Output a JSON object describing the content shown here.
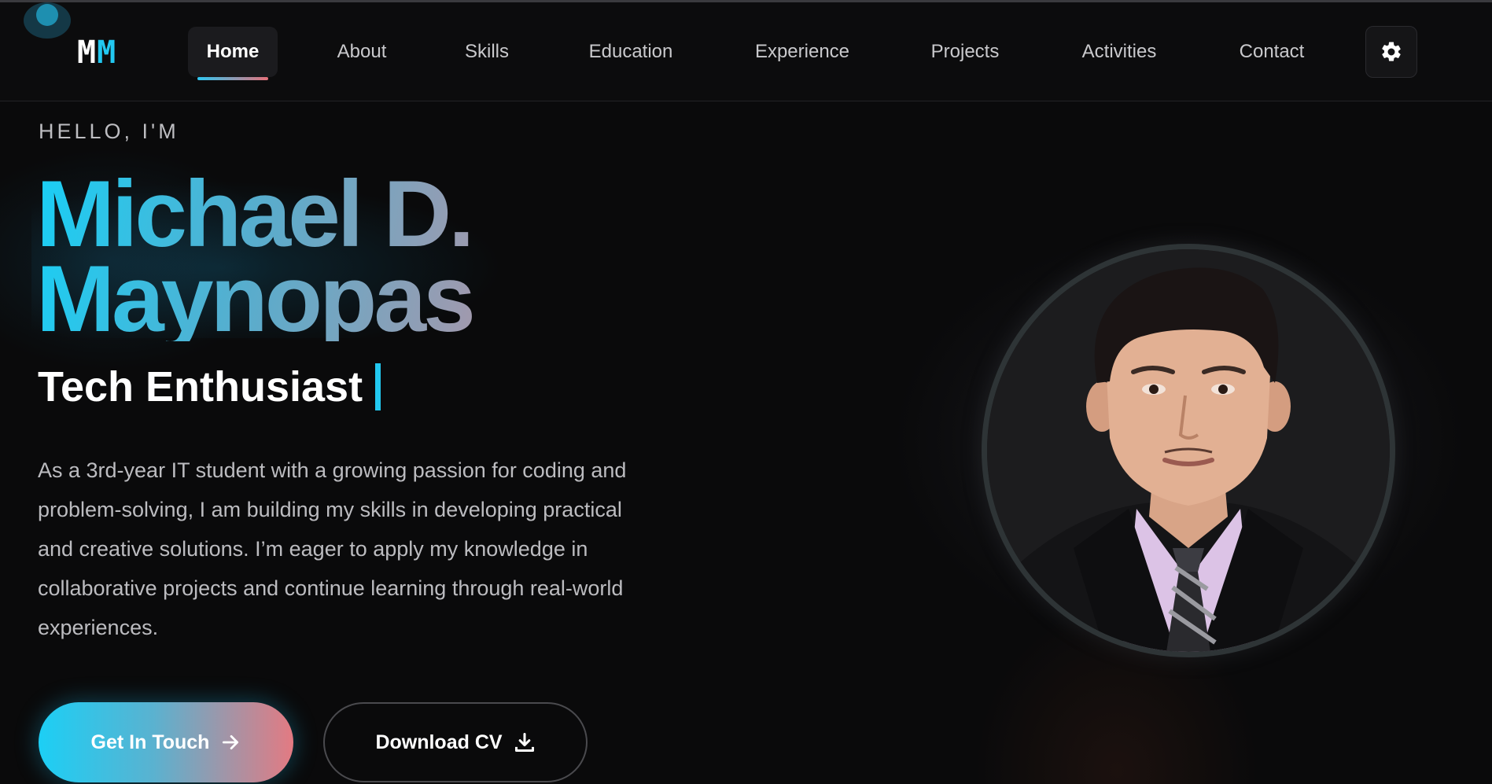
{
  "nav": {
    "logo_first": "M",
    "logo_second": "M",
    "items": [
      {
        "label": "Home",
        "active": true
      },
      {
        "label": "About"
      },
      {
        "label": "Skills"
      },
      {
        "label": "Education"
      },
      {
        "label": "Experience"
      },
      {
        "label": "Projects"
      },
      {
        "label": "Activities"
      },
      {
        "label": "Contact"
      }
    ],
    "theme_icon": "gear-icon"
  },
  "hero": {
    "greeting": "HELLO, I'M",
    "name_line1": "Michael D.",
    "name_line2": "Maynopas",
    "role": "Tech Enthusiast",
    "bio": "As a 3rd-year IT student with a growing passion for coding and problem-solving, I am building my skills in developing practical and creative solutions. I’m eager to apply my knowledge in collaborative projects and continue learning through real-world experiences.",
    "primary_button": "Get In Touch",
    "primary_icon": "arrow-right-icon",
    "secondary_button": "Download CV",
    "secondary_icon": "download-icon"
  },
  "colors": {
    "accent_cyan": "#22c8f0",
    "accent_pink": "#e6717a",
    "background": "#0a0a0b"
  }
}
